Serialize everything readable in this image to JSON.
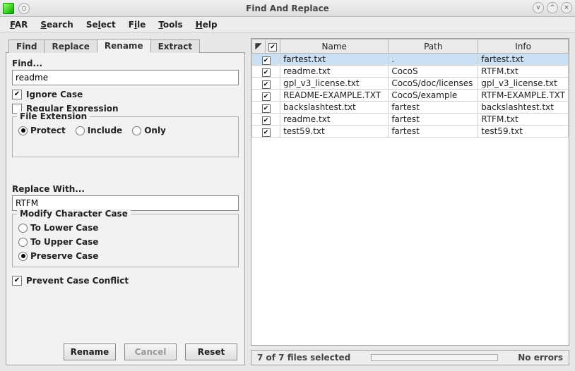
{
  "window": {
    "title": "Find And Replace"
  },
  "menus": [
    "FAR",
    "Search",
    "Select",
    "File",
    "Tools",
    "Help"
  ],
  "tabs": {
    "items": [
      "Find",
      "Replace",
      "Rename",
      "Extract"
    ],
    "active_index": 2
  },
  "rename_panel": {
    "find_label": "Find...",
    "find_value": "readme",
    "ignore_case_label": "Ignore Case",
    "ignore_case_checked": true,
    "regex_label": "Regular Expression",
    "regex_checked": false,
    "file_ext_group_label": "File Extension",
    "file_ext_options": [
      "Protect",
      "Include",
      "Only"
    ],
    "file_ext_selected_index": 0,
    "replace_label": "Replace With...",
    "replace_value": "RTFM",
    "case_group_label": "Modify Character Case",
    "case_options": [
      "To Lower Case",
      "To Upper Case",
      "Preserve Case"
    ],
    "case_selected_index": 2,
    "prevent_conflict_label": "Prevent Case Conflict",
    "prevent_conflict_checked": true
  },
  "buttons": {
    "rename": "Rename",
    "cancel": "Cancel",
    "reset": "Reset"
  },
  "table": {
    "headers": [
      "Name",
      "Path",
      "Info"
    ],
    "rows": [
      {
        "checked": true,
        "selected": true,
        "name": "fartest.txt",
        "path": ".",
        "info": "fartest.txt"
      },
      {
        "checked": true,
        "selected": false,
        "name": "readme.txt",
        "path": "CocoS",
        "info": "RTFM.txt"
      },
      {
        "checked": true,
        "selected": false,
        "name": "gpl_v3_license.txt",
        "path": "CocoS/doc/licenses",
        "info": "gpl_v3_license.txt"
      },
      {
        "checked": true,
        "selected": false,
        "name": "README-EXAMPLE.TXT",
        "path": "CocoS/example",
        "info": "RTFM-EXAMPLE.TXT"
      },
      {
        "checked": true,
        "selected": false,
        "name": "backslashtest.txt",
        "path": "fartest",
        "info": "backslashtest.txt"
      },
      {
        "checked": true,
        "selected": false,
        "name": "readme.txt",
        "path": "fartest",
        "info": "RTFM.txt"
      },
      {
        "checked": true,
        "selected": false,
        "name": "test59.txt",
        "path": "fartest",
        "info": "test59.txt"
      }
    ]
  },
  "status": {
    "selected_text": "7 of 7 files selected",
    "errors_text": "No errors"
  }
}
